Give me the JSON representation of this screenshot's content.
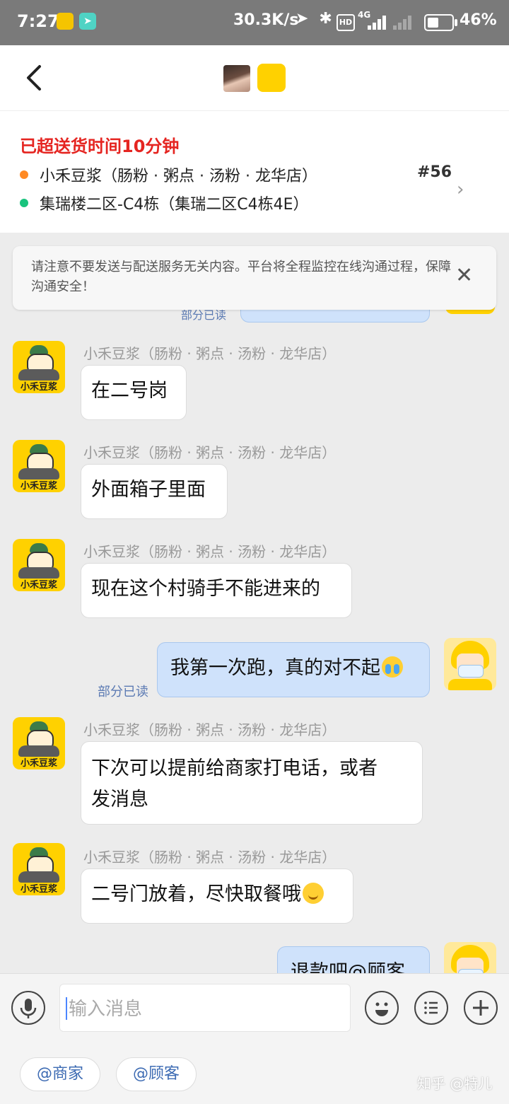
{
  "status_bar": {
    "time": "7:27",
    "net_speed": "30.3K/s",
    "network_type": "4G",
    "hd_label": "HD",
    "battery": "46%",
    "battery_level": 0.46
  },
  "header": {
    "back_icon": "chevron-left-icon"
  },
  "order": {
    "overdue_text": "已超送货时间10分钟",
    "shop_name": "小禾豆浆（肠粉 · 粥点 · 汤粉 · 龙华店）",
    "address": "集瑞楼二区-C4栋（集瑞二区C4栋4E）",
    "order_number": "#56",
    "colors": {
      "alert": "#e52521",
      "shop_dot": "#ff8a24",
      "address_dot": "#19c37d"
    }
  },
  "notice": {
    "text": "请注意不要发送与配送服务无关内容。平台将全程监控在线沟通过程，保障沟通安全！"
  },
  "chat": {
    "shop_avatar_caption": "小禾豆浆",
    "partial_read": "部分已读",
    "messages": [
      {
        "sender": "shop",
        "name": "小禾豆浆（肠粉 · 粥点 · 汤粉 · 龙华店）",
        "text": "在二号岗"
      },
      {
        "sender": "shop",
        "name": "小禾豆浆（肠粉 · 粥点 · 汤粉 · 龙华店）",
        "text": "外面箱子里面"
      },
      {
        "sender": "shop",
        "name": "小禾豆浆（肠粉 · 粥点 · 汤粉 · 龙华店）",
        "text": "现在这个村骑手不能进来的"
      },
      {
        "sender": "rider",
        "text": "我第一次跑，真的对不起",
        "emoji": "crying-face",
        "read_status": "部分已读"
      },
      {
        "sender": "shop",
        "name": "小禾豆浆（肠粉 · 粥点 · 汤粉 · 龙华店）",
        "text_line1": "下次可以提前给商家打电话，或者",
        "text_line2": "发消息"
      },
      {
        "sender": "shop",
        "name": "小禾豆浆（肠粉 · 粥点 · 汤粉 · 龙华店）",
        "text": "二号门放着，尽快取餐哦",
        "emoji": "smiling-face"
      },
      {
        "sender": "rider",
        "text": "退款吧@顾客"
      }
    ]
  },
  "input_bar": {
    "placeholder": "输入消息",
    "mention_merchant": "@商家",
    "mention_customer": "@顾客",
    "voice_icon": "microphone-icon",
    "emoji_icon": "emoji-icon",
    "menu_icon": "list-menu-icon",
    "plus_icon": "plus-icon"
  },
  "watermark": "知乎 @特儿"
}
